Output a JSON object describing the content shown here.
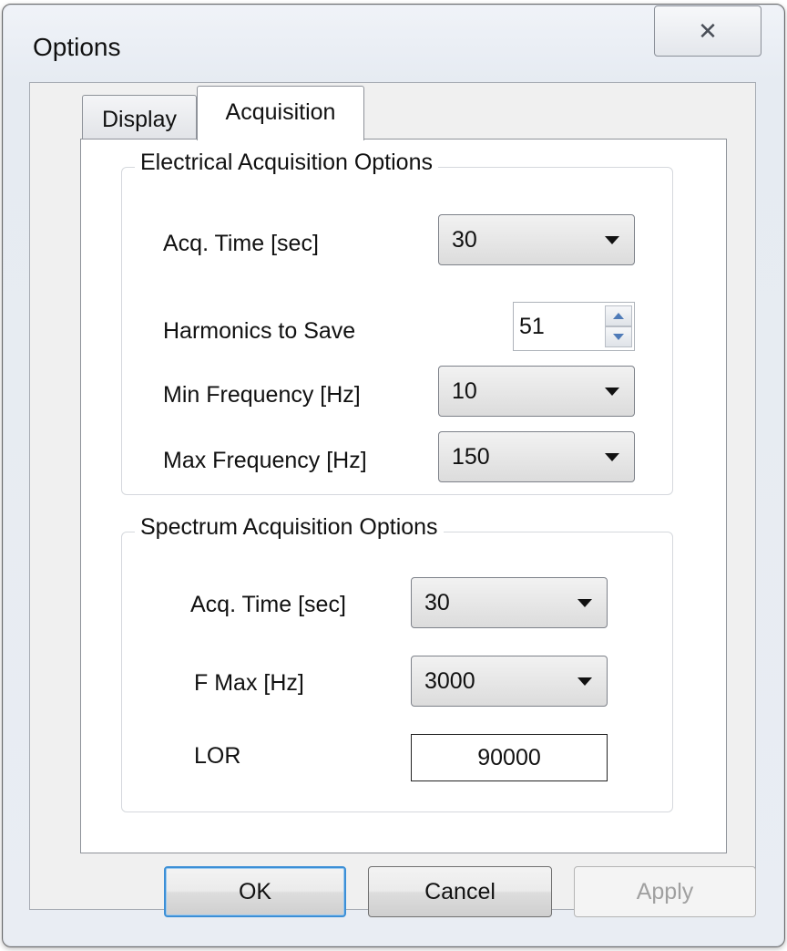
{
  "window": {
    "title": "Options",
    "close_icon": "close-icon"
  },
  "tabs": [
    {
      "label": "Display",
      "selected": false
    },
    {
      "label": "Acquisition",
      "selected": true
    }
  ],
  "electrical": {
    "legend": "Electrical Acquisition Options",
    "acq_time_label": "Acq. Time [sec]",
    "acq_time_value": "30",
    "harmonics_label": "Harmonics to Save",
    "harmonics_value": "51",
    "min_freq_label": "Min Frequency [Hz]",
    "min_freq_value": "10",
    "max_freq_label": "Max Frequency [Hz]",
    "max_freq_value": "150"
  },
  "spectrum": {
    "legend": "Spectrum Acquisition Options",
    "acq_time_label": "Acq. Time [sec]",
    "acq_time_value": "30",
    "fmax_label": "F Max [Hz]",
    "fmax_value": "3000",
    "lor_label": "LOR",
    "lor_value": "90000"
  },
  "buttons": {
    "ok": "OK",
    "cancel": "Cancel",
    "apply": "Apply"
  }
}
